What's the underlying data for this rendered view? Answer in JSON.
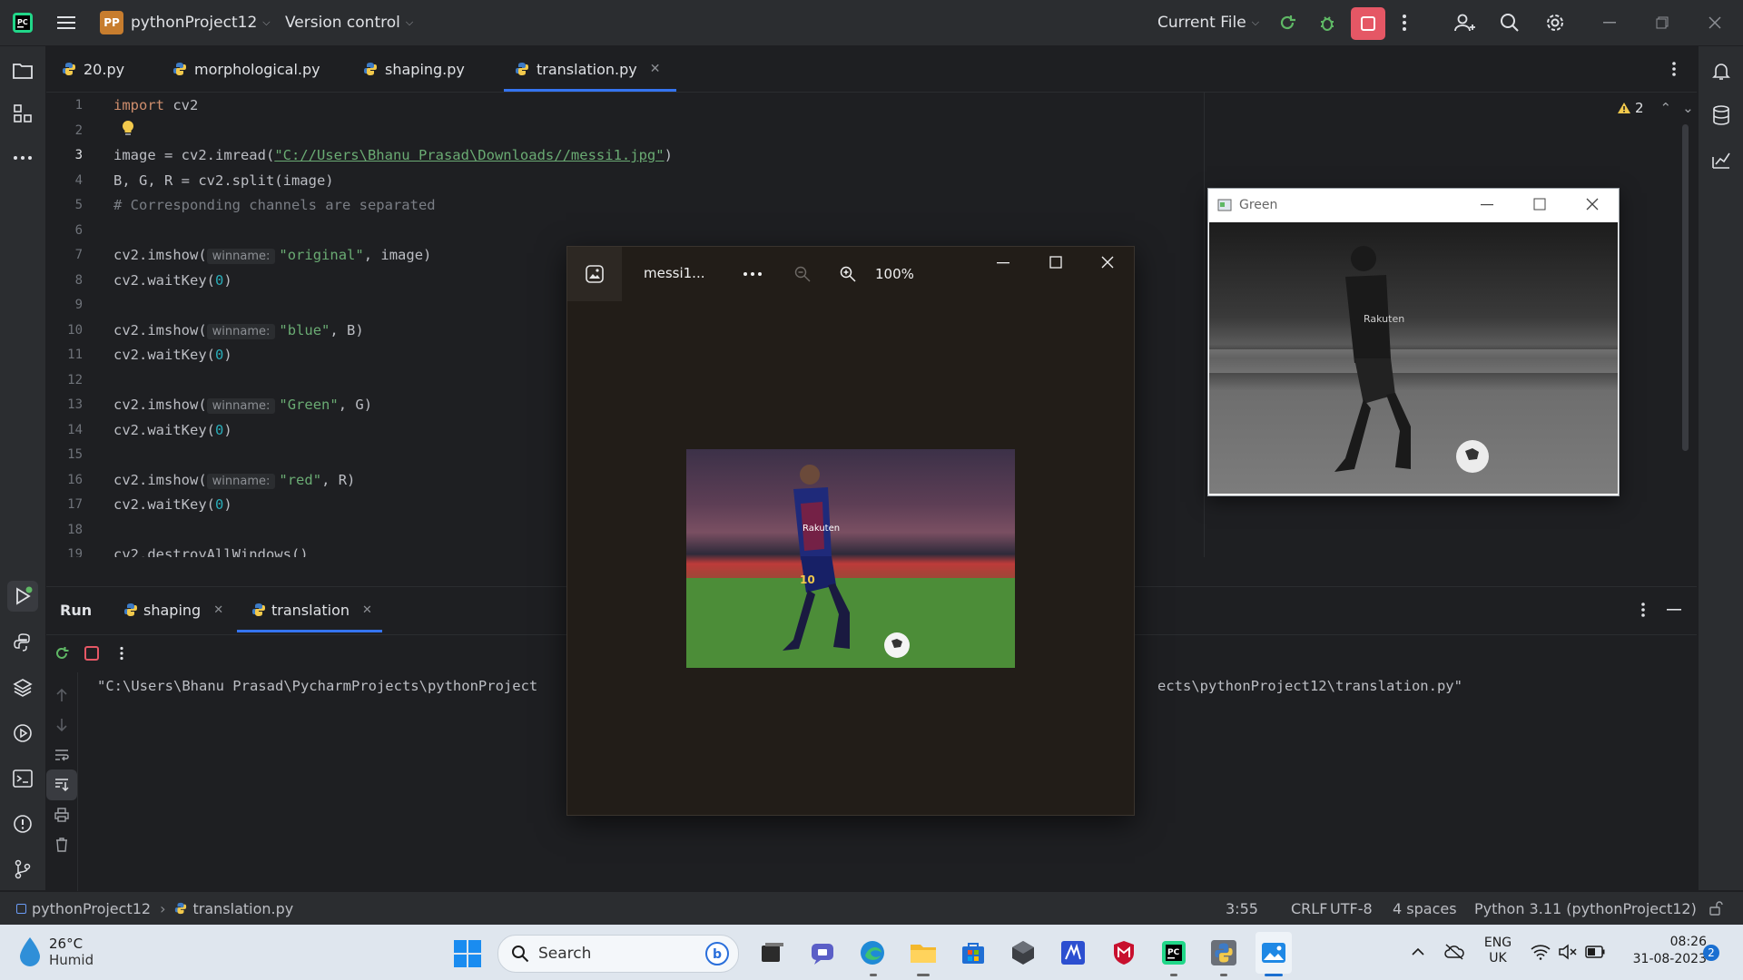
{
  "titlebar": {
    "project_badge": "PP",
    "project_name": "pythonProject12",
    "vcs_label": "Version control",
    "run_config": "Current File"
  },
  "tabs": [
    {
      "label": "20.py"
    },
    {
      "label": "morphological.py"
    },
    {
      "label": "shaping.py"
    },
    {
      "label": "translation.py"
    }
  ],
  "editor": {
    "line_numbers": [
      "1",
      "2",
      "3",
      "4",
      "5",
      "6",
      "7",
      "8",
      "9",
      "10",
      "11",
      "12",
      "13",
      "14",
      "15",
      "16",
      "17",
      "18",
      "19"
    ],
    "lines": {
      "l1_kw": "import",
      "l1_rest": " cv2",
      "l3_a": "image = cv2.imread(",
      "l3_str": "\"C://Users\\Bhanu Prasad\\Downloads//messi1.jpg\"",
      "l3_b": ")",
      "l4": "B, G, R = cv2.split(image)",
      "l5": "# Corresponding channels are separated",
      "imshow": "cv2.imshow(",
      "hint": "winname:",
      "l7_str": "\"original\"",
      "l7_rest": ", image)",
      "waitkey_a": "cv2.waitKey(",
      "waitkey_num": "0",
      "waitkey_b": ")",
      "l10_str": "\"blue\"",
      "l10_rest": ", B)",
      "l13_str": "\"Green\"",
      "l13_rest": ", G)",
      "l16_str": "\"red\"",
      "l16_rest": ", R)",
      "l19": "cv2.destroyAllWindows()"
    },
    "warnings_count": "2"
  },
  "run_panel": {
    "title": "Run",
    "tabs": [
      {
        "label": "shaping"
      },
      {
        "label": "translation"
      }
    ],
    "output_left": "\"C:\\Users\\Bhanu Prasad\\PycharmProjects\\pythonProject",
    "output_right": "ects\\pythonProject12\\translation.py\""
  },
  "viewer": {
    "filename": "messi1...",
    "zoom": "100%"
  },
  "green_window": {
    "title": "Green"
  },
  "statusbar": {
    "project": "pythonProject12",
    "file": "translation.py",
    "position": "3:55",
    "line_sep": "CRLF",
    "encoding": "UTF-8",
    "indent": "4 spaces",
    "interpreter": "Python 3.11 (pythonProject12)"
  },
  "taskbar": {
    "temp": "26°C",
    "weather": "Humid",
    "search_placeholder": "Search",
    "lang_top": "ENG",
    "lang_bottom": "UK",
    "time": "08:26",
    "date": "31-08-2023",
    "notif_count": "2"
  },
  "colors": {
    "accent": "#3574f0",
    "stop_red": "#e55765",
    "run_green": "#5fb865",
    "string": "#6aab73",
    "keyword": "#cf8e6d"
  }
}
